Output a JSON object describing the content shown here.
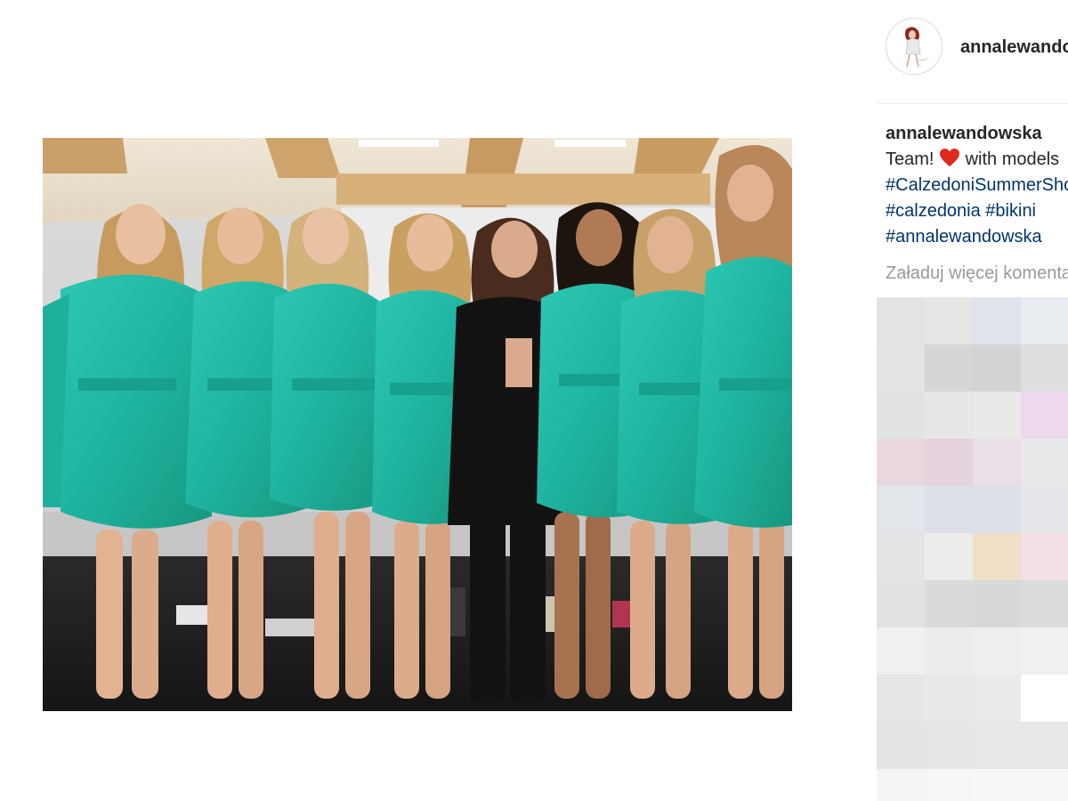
{
  "post": {
    "username": "annalewandowska",
    "caption": {
      "username": "annalewandowska",
      "line1_before_heart": "Team! ",
      "line1_after_heart": " with models",
      "hashtag_lines": [
        "#CalzedoniSummerShow",
        "#calzedonia #bikini",
        "#annalewandowska"
      ]
    },
    "load_more_comments": "Załaduj więcej komentarzy"
  },
  "icons": {
    "avatar": "profile-avatar-drawing",
    "heart": "red-heart-emoji"
  },
  "colors": {
    "text": "#262626",
    "hashtag": "#003569",
    "muted": "#999999",
    "heart": "#e0281c",
    "robe_teal": "#22b8a4"
  },
  "blurred_comments": [
    [
      "#e3e3e3",
      "#e6e6e6",
      "#dfe4ec",
      "#e9ecf1"
    ],
    [
      "#e4e4e4",
      "#d6d6d6",
      "#d3d3d3",
      "#dedede"
    ],
    [
      "#e2e2e2",
      "#e7e7e7",
      "#e9e9e9",
      "#edd8ec"
    ],
    [
      "#e8d7df",
      "#e6d2dc",
      "#e8e0e6",
      "#e9e9e9"
    ],
    [
      "#e2e5ea",
      "#dcdfe5",
      "#dde0e6",
      "#e5e7eb"
    ],
    [
      "#e4e4e4",
      "#ececec",
      "#f0dfc6",
      "#f3dfe3"
    ],
    [
      "#e2e2e2",
      "#dadada",
      "#d8d8d8",
      "#dcdcdc"
    ],
    [
      "#f0f0f0",
      "#ececec",
      "#eeeeee",
      "#f1f1f1"
    ],
    [
      "#e6e6e6",
      "#e9e9e9",
      "#eaeaea",
      "#ffffff"
    ],
    [
      "#e4e4e4",
      "#e6e6e6",
      "#e8e8e8",
      "#e8e8e8"
    ],
    [
      "#f5f5f5",
      "#f6f6f6",
      "#f7f7f7",
      "#f7f7f7"
    ]
  ]
}
